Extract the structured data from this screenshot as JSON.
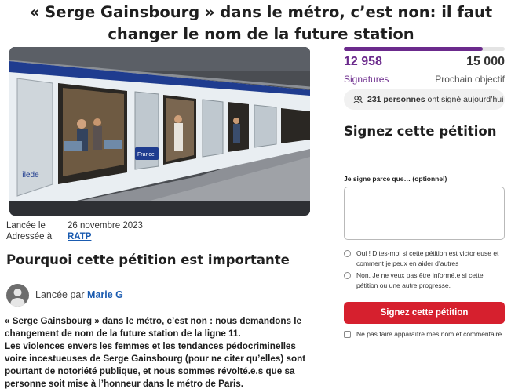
{
  "petition": {
    "title_line1": "« Serge Gainsbourg » dans le métro, c’est non: il faut",
    "title_line2": "changer le nom de la future station"
  },
  "photo": {
    "icon": "metro-train-photo",
    "caption_text": "îlede",
    "logo_text": "France",
    "logo_sub": "mobilités"
  },
  "meta": {
    "launched_label": "Lancée le",
    "launched_date": "26 novembre 2023",
    "addressed_label": "Adressée à",
    "addressed_to": "RATP"
  },
  "why": {
    "heading": "Pourquoi cette pétition est importante"
  },
  "author": {
    "prefix": "Lancée par",
    "name": "Marie G",
    "icon": "user-avatar-icon"
  },
  "body": {
    "p1": "« Serge Gainsbourg » dans le métro, c’est non : nous demandons le changement de nom de la future station de la ligne 11.",
    "p2": "Les violences envers les femmes et les tendances pédocriminelles voire incestueuses de Serge Gainsbourg (pour ne citer qu’elles) sont pourtant de notoriété publique, et nous sommes révolté.e.s que sa personne soit mise à l’honneur dans le métro de Paris."
  },
  "progress": {
    "count": "12 958",
    "goal": "15 000",
    "count_label": "Signatures",
    "goal_label": "Prochain objectif",
    "fraction": 0.864,
    "color": "#6b2a8c"
  },
  "today": {
    "count": "231 personnes",
    "suffix": "ont signé aujourd’hui",
    "icon": "people-icon"
  },
  "form": {
    "heading": "Signez cette pétition",
    "reason_label": "Je signe parce que… (optionnel)",
    "option_yes": "Oui ! Dites-moi si cette pétition est victorieuse et comment je peux en aider d’autres",
    "option_no": "Non. Je ne veux pas être informé.e si cette pétition ou une autre progresse.",
    "sign_button": "Signez cette pétition",
    "sign_button_color": "#d6202e",
    "hide_name": "Ne pas faire apparaître mes nom et commentaire"
  }
}
